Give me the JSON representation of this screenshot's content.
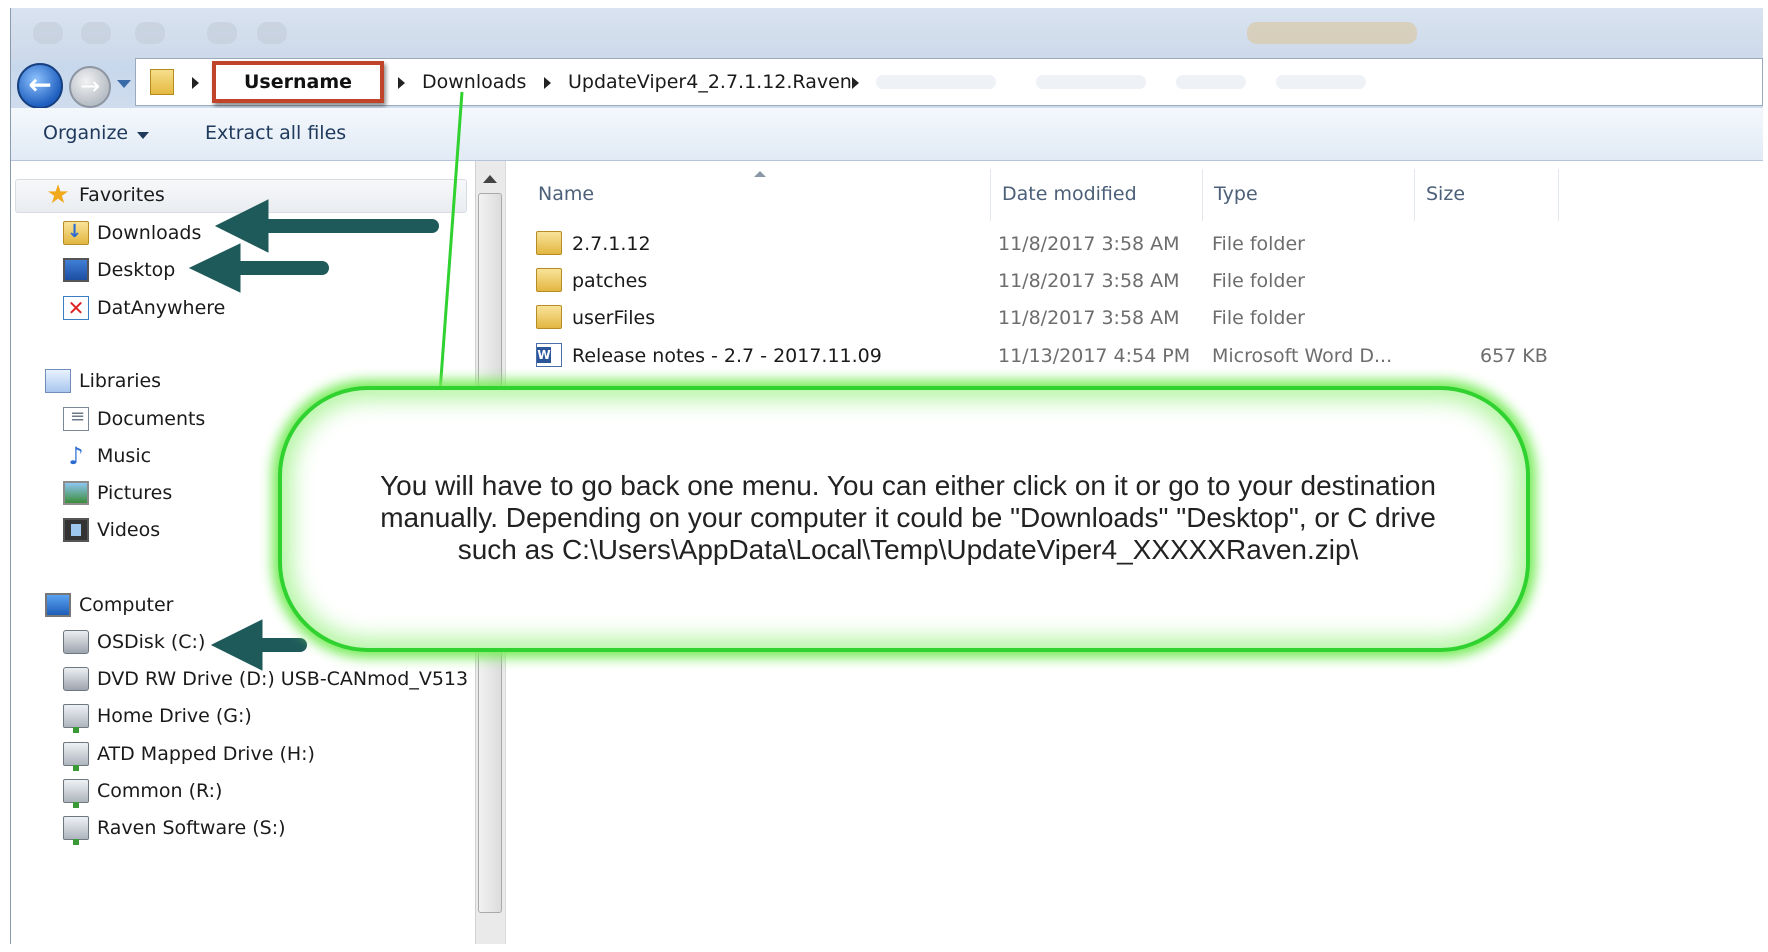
{
  "address_bar": {
    "crumbs": [
      "Username",
      "Downloads",
      "UpdateViper4_2.7.1.12.Raven"
    ]
  },
  "toolbar": {
    "organize_label": "Organize",
    "extract_label": "Extract all files"
  },
  "nav": {
    "favorites": {
      "label": "Favorites",
      "items": [
        "Downloads",
        "Desktop",
        "DatAnywhere"
      ]
    },
    "libraries": {
      "label": "Libraries",
      "items": [
        "Documents",
        "Music",
        "Pictures",
        "Videos"
      ]
    },
    "computer": {
      "label": "Computer",
      "items": [
        "OSDisk (C:)",
        "DVD RW Drive (D:) USB-CANmod_V513",
        "Home Drive (G:)",
        "ATD Mapped Drive (H:)",
        "Common (R:)",
        "Raven Software (S:)"
      ]
    }
  },
  "columns": {
    "name": "Name",
    "date": "Date modified",
    "type": "Type",
    "size": "Size"
  },
  "files": [
    {
      "name": "2.7.1.12",
      "date": "11/8/2017 3:58 AM",
      "type": "File folder",
      "size": "",
      "icon": "folder-icon"
    },
    {
      "name": "patches",
      "date": "11/8/2017 3:58 AM",
      "type": "File folder",
      "size": "",
      "icon": "folder-icon"
    },
    {
      "name": "userFiles",
      "date": "11/8/2017 3:58 AM",
      "type": "File folder",
      "size": "",
      "icon": "folder-icon"
    },
    {
      "name": "Release notes - 2.7 - 2017.11.09",
      "date": "11/13/2017 4:54 PM",
      "type": "Microsoft Word D...",
      "size": "657 KB",
      "icon": "word-document-icon"
    }
  ],
  "callout": {
    "lines": [
      "You will have to go back one menu. You can either click on it or go to your destination",
      "manually. Depending on your computer it could be \"Downloads\" \"Desktop\", or C drive",
      "such as C:\\Users\\AppData\\Local\\Temp\\UpdateViper4_XXXXXRaven.zip\\"
    ]
  },
  "colors": {
    "callout_border": "#2fd22f",
    "arrow": "#1f5a5a",
    "highlight_box": "#c0442a",
    "toolbar_text": "#1e395b"
  }
}
